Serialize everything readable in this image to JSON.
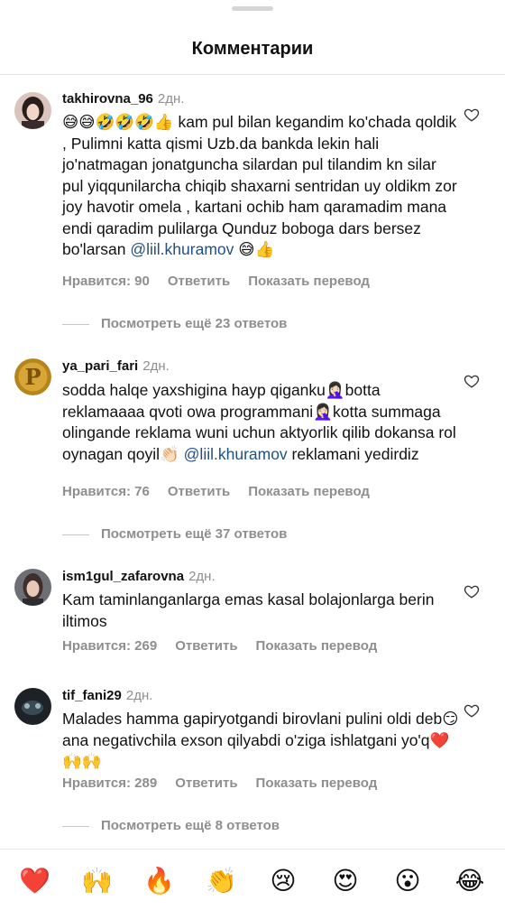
{
  "header": {
    "title": "Комментарии"
  },
  "actions": {
    "like": "Нравится",
    "reply": "Ответить",
    "translate": "Показать перевод"
  },
  "comments": [
    {
      "user": "takhirovna_96",
      "time": "2дн.",
      "text": "😅😅🤣🤣🤣👍 kam pul bilan kegandim ko'chada qoldik , Pulimni katta qismi Uzb.da bankda lekin hali jo'natmagan jonatguncha silardan pul tilandim kn silar pul yiqqunilarcha chiqib shaxarni sentridan uy oldikm zor joy havotir omela , kartani ochib ham qaramadim mana endi qaradim pulilarga Qunduz boboga dars bersez bo'larsan",
      "mention": "@liil.khuramov",
      "text_after": " 😅👍",
      "likes": "Нравится: 90",
      "replies": "Посмотреть ещё 23 ответов"
    },
    {
      "user": "ya_pari_fari",
      "time": "2дн.",
      "text": "sodda halqe yaxshigina hayp qiganku🤦🏻‍♀️botta reklamaaaa qvoti owa programmani🤦🏻‍♀️kotta summaga olingande reklama wuni uchun aktyorlik qilib dokansa rol oynagan qoyil👏🏻",
      "mention": "@liil.khuramov",
      "text_after": " reklamani yedirdiz",
      "likes": "Нравится: 76",
      "replies": "Посмотреть ещё 37 ответов"
    },
    {
      "user": "ism1gul_zafarovna",
      "time": "2дн.",
      "text": "Kam taminlanganlarga emas kasal bolajonlarga berin iltimos",
      "likes": "Нравится: 269"
    },
    {
      "user": "tif_fani29",
      "time": "2дн.",
      "text": "Malades hamma gapiryotgandi birovlani pulini oldi deb😏ana negativchila exson qilyabdi o'ziga ishlatgani yo'q❤️🙌🙌",
      "likes": "Нравится: 289",
      "replies": "Посмотреть ещё 8 ответов"
    }
  ],
  "reactions": [
    "❤️",
    "🙌",
    "🔥",
    "👏",
    "😢",
    "😍",
    "😮",
    "😂"
  ]
}
